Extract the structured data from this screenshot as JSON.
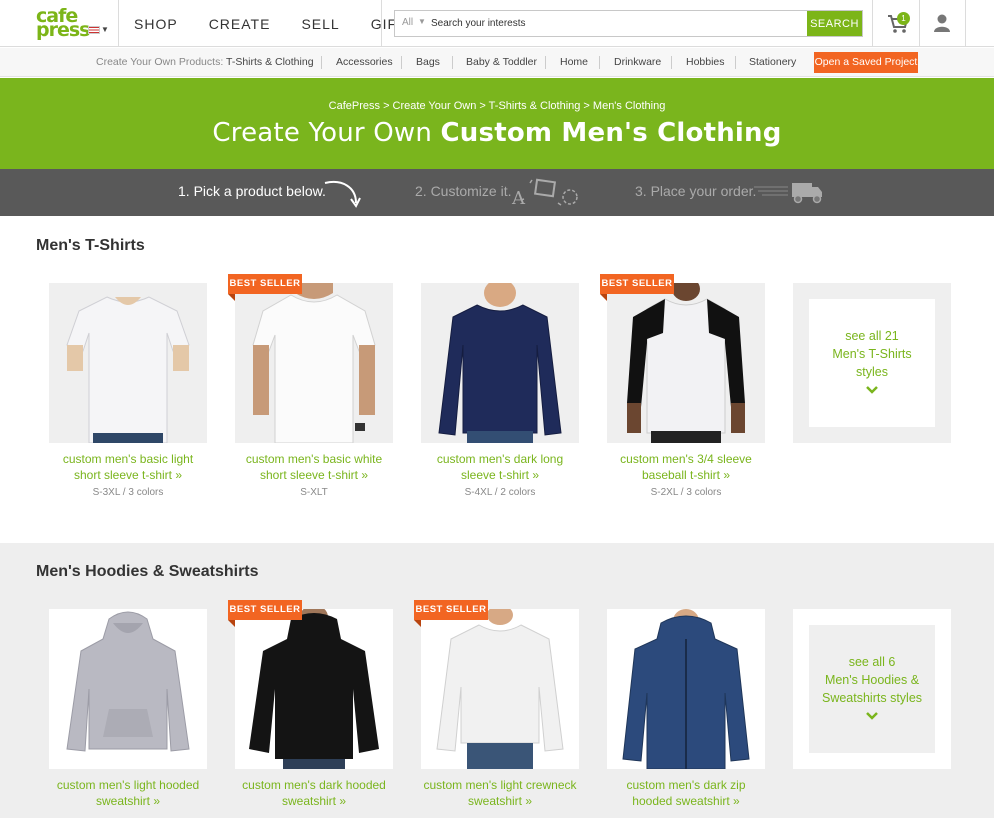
{
  "header": {
    "logo_line1": "cafe",
    "logo_line2": "press",
    "nav": [
      "SHOP",
      "CREATE",
      "SELL",
      "GIFTS"
    ],
    "search": {
      "scope": "All",
      "placeholder": "Search your interests",
      "button": "SEARCH"
    },
    "cart_count": "1"
  },
  "subnav": {
    "label": "Create Your Own Products:",
    "items": [
      "T-Shirts & Clothing",
      "Accessories",
      "Bags",
      "Baby & Toddler",
      "Home",
      "Drinkware",
      "Hobbies",
      "Stationery"
    ],
    "saved_button": "Open a Saved Project"
  },
  "hero": {
    "breadcrumb": "CafePress > Create Your Own > T-Shirts & Clothing > Men's Clothing",
    "title_prefix": "Create Your Own ",
    "title_bold": "Custom Men's Clothing"
  },
  "steps": [
    "1. Pick a product below.",
    "2. Customize it.",
    "3. Place your order."
  ],
  "colors": {
    "brand_green": "#7ab51d",
    "accent_orange": "#f26522",
    "steps_bar": "#595959"
  },
  "sections": [
    {
      "title": "Men's T-Shirts",
      "products": [
        {
          "line1": "custom men's basic light",
          "line2": "short sleeve t-shirt »",
          "meta": "S-3XL / 3 colors",
          "badge": ""
        },
        {
          "line1": "custom men's basic white",
          "line2": "short sleeve t-shirt »",
          "meta": "S-XLT",
          "badge": "BEST SELLER"
        },
        {
          "line1": "custom men's dark long",
          "line2": "sleeve t-shirt »",
          "meta": "S-4XL / 2 colors",
          "badge": ""
        },
        {
          "line1": "custom men's 3/4 sleeve",
          "line2": "baseball t-shirt »",
          "meta": "S-2XL / 3 colors",
          "badge": "BEST SELLER"
        }
      ],
      "see_all": [
        "see all 21",
        "Men's T-Shirts",
        "styles"
      ]
    },
    {
      "title": "Men's Hoodies & Sweatshirts",
      "products": [
        {
          "line1": "custom men's light hooded",
          "line2": "sweatshirt »",
          "badge": ""
        },
        {
          "line1": "custom men's dark hooded",
          "line2": "sweatshirt »",
          "badge": "BEST SELLER"
        },
        {
          "line1": "custom men's light crewneck",
          "line2": "sweatshirt »",
          "badge": "BEST SELLER"
        },
        {
          "line1": "custom men's dark zip",
          "line2": "hooded sweatshirt »",
          "badge": ""
        }
      ],
      "see_all": [
        "see all 6",
        "Men's Hoodies &",
        "Sweatshirts styles"
      ]
    }
  ]
}
